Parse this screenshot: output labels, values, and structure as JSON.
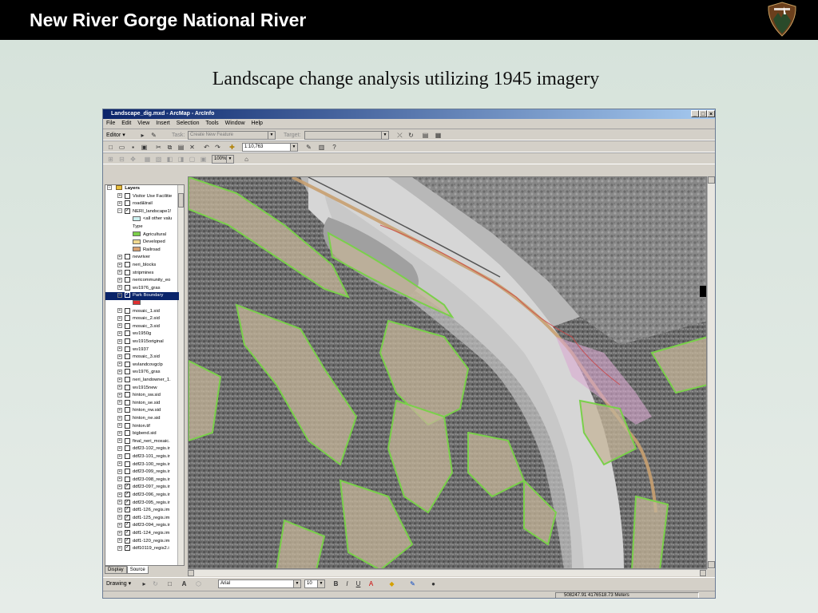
{
  "slide": {
    "header_title": "New River Gorge National River",
    "subtitle": "Landscape change analysis utilizing 1945 imagery"
  },
  "window": {
    "title": "Landscape_dig.mxd - ArcMap - ArcInfo",
    "controls": [
      "_",
      "□",
      "×"
    ]
  },
  "menu": [
    "File",
    "Edit",
    "View",
    "Insert",
    "Selection",
    "Tools",
    "Window",
    "Help"
  ],
  "editor_toolbar": {
    "editor_label": "Editor ▾",
    "task_label": "Task:",
    "task_value": "Create New Feature",
    "target_label": "Target:",
    "target_value": ""
  },
  "standard_toolbar": {
    "scale": "1:10,763"
  },
  "georef_toolbar": {
    "zoom": "100%"
  },
  "toc": {
    "tabs": [
      "Display",
      "Source"
    ],
    "root": "Layers",
    "layers": [
      {
        "name": "Visitor Use Facilitie",
        "checked": false,
        "expanded": false
      },
      {
        "name": "road&trail",
        "checked": false,
        "expanded": false
      },
      {
        "name": "NERI_landscape1!",
        "checked": true,
        "expanded": true
      },
      {
        "name": "<all other valu",
        "swatch": "#ccf0f0",
        "sub": true
      },
      {
        "name": "Type",
        "sub": true
      },
      {
        "name": "Agricultural",
        "swatch": "#7ccf4a",
        "sub": true
      },
      {
        "name": "Developed",
        "swatch": "#f0d890",
        "sub": true
      },
      {
        "name": "Railroad",
        "swatch": "#d8a070",
        "sub": true
      },
      {
        "name": "newriver",
        "checked": false,
        "expanded": false
      },
      {
        "name": "neri_blocks",
        "checked": false,
        "expanded": false
      },
      {
        "name": "stripmines",
        "checked": false,
        "expanded": false
      },
      {
        "name": "nericommunity_eo",
        "checked": false,
        "expanded": false
      },
      {
        "name": "wv1976_gras",
        "checked": false,
        "expanded": false
      },
      {
        "name": "Park Boundary",
        "checked": true,
        "expanded": true,
        "selected": true
      },
      {
        "name": "",
        "swatch": "#e03030",
        "sub": true
      },
      {
        "name": "mosaic_1.sid",
        "checked": false,
        "expanded": false
      },
      {
        "name": "mosaic_2.sid",
        "checked": false,
        "expanded": false
      },
      {
        "name": "mosaic_3.sid",
        "checked": false,
        "expanded": false
      },
      {
        "name": "wv1950g",
        "checked": false,
        "expanded": false
      },
      {
        "name": "wv1915original",
        "checked": false,
        "expanded": false
      },
      {
        "name": "wv1937",
        "checked": false,
        "expanded": false
      },
      {
        "name": "mosaic_3.sid",
        "checked": false,
        "expanded": false
      },
      {
        "name": "wvlandcovgclp",
        "checked": false,
        "expanded": false
      },
      {
        "name": "wv1976_gras",
        "checked": false,
        "expanded": false
      },
      {
        "name": "neri_landowner_1.",
        "checked": false,
        "expanded": false
      },
      {
        "name": "wv1915new",
        "checked": false,
        "expanded": false
      },
      {
        "name": "hinton_sw.sid",
        "checked": false,
        "expanded": false
      },
      {
        "name": "hinton_se.sid",
        "checked": false,
        "expanded": false
      },
      {
        "name": "hinton_nw.sid",
        "checked": false,
        "expanded": false
      },
      {
        "name": "hinton_ne.sid",
        "checked": false,
        "expanded": false
      },
      {
        "name": "hinton.tif",
        "checked": false,
        "expanded": false
      },
      {
        "name": "bigbend.sid",
        "checked": false,
        "expanded": false
      },
      {
        "name": "final_neri_mosaic.",
        "checked": false,
        "expanded": false
      },
      {
        "name": "ddf23-102_regis.ir",
        "checked": false,
        "expanded": false
      },
      {
        "name": "ddf23-101_regis.ir",
        "checked": false,
        "expanded": false
      },
      {
        "name": "ddf23-100_regis.ir",
        "checked": false,
        "expanded": false
      },
      {
        "name": "ddf23-099_regis.ir",
        "checked": false,
        "expanded": false
      },
      {
        "name": "ddf23-098_regis.ir",
        "checked": false,
        "expanded": false
      },
      {
        "name": "ddf23-097_regis.ir",
        "checked": true,
        "expanded": false
      },
      {
        "name": "ddf23-096_regis.ir",
        "checked": true,
        "expanded": false
      },
      {
        "name": "ddf23-095_regis.ir",
        "checked": true,
        "expanded": false
      },
      {
        "name": "ddf1-126_regis.im",
        "checked": true,
        "expanded": false
      },
      {
        "name": "ddf1-125_regis.im",
        "checked": true,
        "expanded": false
      },
      {
        "name": "ddf23-094_regis.ir",
        "checked": true,
        "expanded": false
      },
      {
        "name": "ddf1-124_regis.im",
        "checked": true,
        "expanded": false
      },
      {
        "name": "ddf1-120_regis.im",
        "checked": true,
        "expanded": false
      },
      {
        "name": "ddf10119_regis2.i",
        "checked": true,
        "expanded": false
      }
    ]
  },
  "drawing_toolbar": {
    "drawing_label": "Drawing ▾",
    "font": "Arial",
    "size": "10"
  },
  "status": {
    "coordinates": "508247.91  4176518.73 Meters"
  }
}
